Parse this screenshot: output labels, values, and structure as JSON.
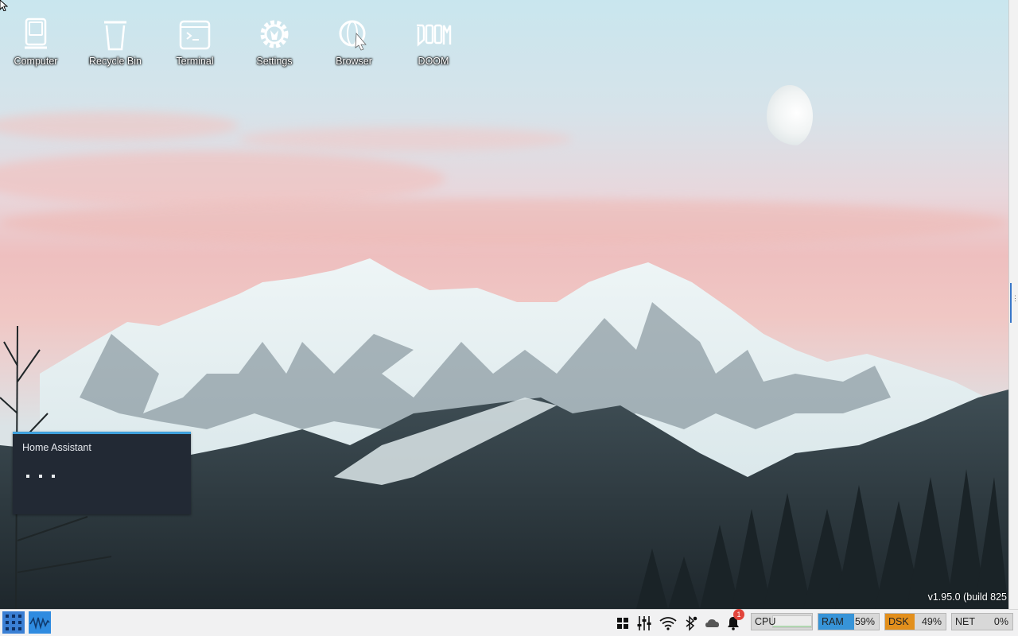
{
  "desktop": {
    "icons": [
      {
        "label": "Computer",
        "icon": "computer-icon"
      },
      {
        "label": "Recycle Bin",
        "icon": "recycle-bin-icon"
      },
      {
        "label": "Terminal",
        "icon": "terminal-icon"
      },
      {
        "label": "Settings",
        "icon": "settings-gear-icon"
      },
      {
        "label": "Browser",
        "icon": "browser-globe-icon"
      },
      {
        "label": "DOOM",
        "icon": "doom-logo-icon"
      }
    ],
    "widget": {
      "title": "Home Assistant",
      "loading_indicator": "loading-dots-icon"
    },
    "version": "v1.95.0 (build 825"
  },
  "taskbar": {
    "start_icon": "app-launcher-grid-icon",
    "active_app_icon": "waveform-app-icon",
    "tray": [
      {
        "icon": "window-tiles-icon"
      },
      {
        "icon": "mixer-sliders-icon"
      },
      {
        "icon": "wifi-icon"
      },
      {
        "icon": "bluetooth-icon"
      },
      {
        "icon": "cloud-icon"
      },
      {
        "icon": "bell-notification-icon"
      }
    ],
    "notification_count": "1",
    "meters": {
      "cpu": {
        "label": "CPU",
        "value": "",
        "fraction": 0.02
      },
      "ram": {
        "label": "RAM",
        "value": "59%",
        "fraction": 0.59
      },
      "dsk": {
        "label": "DSK",
        "value": "49%",
        "fraction": 0.49
      },
      "net": {
        "label": "NET",
        "value": "0%",
        "fraction": 0.0
      }
    }
  },
  "colors": {
    "accent": "#3fa0dc",
    "taskbar_bg": "#f1f1f2",
    "widget_bg": "#222934",
    "ram_fill": "#3794d8",
    "dsk_fill": "#e28f1c",
    "badge": "#e2453c",
    "cpu_line": "#5cb85c"
  }
}
